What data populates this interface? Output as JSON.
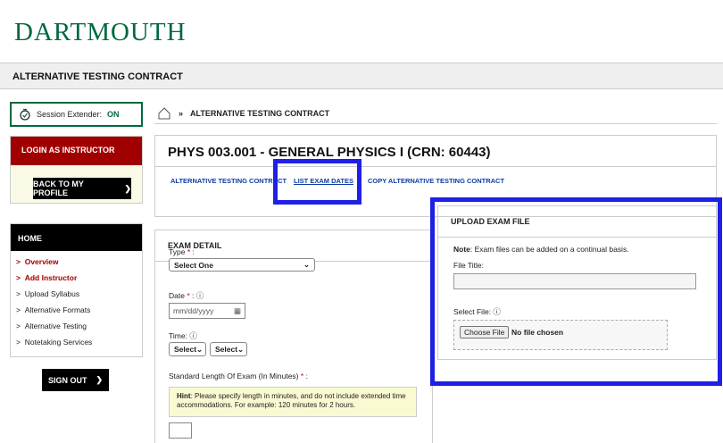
{
  "brand": {
    "logo_text": "DARTMOUTH"
  },
  "page": {
    "title": "ALTERNATIVE TESTING CONTRACT"
  },
  "session": {
    "label": "Session Extender:",
    "status": "ON"
  },
  "login": {
    "heading": "LOGIN AS INSTRUCTOR",
    "back_label": "BACK TO MY PROFILE"
  },
  "nav": {
    "heading": "HOME",
    "items": [
      {
        "label": "Overview",
        "active": true
      },
      {
        "label": "Add Instructor",
        "active": true
      },
      {
        "label": "Upload Syllabus",
        "active": false
      },
      {
        "label": "Alternative Formats",
        "active": false
      },
      {
        "label": "Alternative Testing",
        "active": false
      },
      {
        "label": "Notetaking Services",
        "active": false
      }
    ],
    "signout_label": "SIGN OUT"
  },
  "breadcrumb": {
    "separator": "»",
    "current": "ALTERNATIVE TESTING CONTRACT"
  },
  "course": {
    "title": "PHYS 003.001 - GENERAL PHYSICS I (CRN: 60443)",
    "tabs": [
      "ALTERNATIVE TESTING CONTRACT",
      "LIST EXAM DATES",
      "COPY ALTERNATIVE TESTING CONTRACT"
    ]
  },
  "exam_detail": {
    "heading": "EXAM DETAIL",
    "type_label": "Type",
    "type_value": "Select One",
    "date_label": "Date",
    "date_placeholder": "mm/dd/yyyy",
    "time_label": "Time:",
    "hour_value": "Select",
    "minute_value": "Select",
    "length_label": "Standard Length Of Exam (In Minutes)",
    "required_mark": "*",
    "hint_bold": "Hint",
    "hint_text": ": Please specify length in minutes, and do not include extended time accommodations. For example: 120 minutes for 2 hours."
  },
  "upload": {
    "heading": "UPLOAD EXAM FILE",
    "note_bold": "Note",
    "note_text": ": Exam files can be added on a continual basis.",
    "file_title_label": "File Title:",
    "select_file_label": "Select File:",
    "choose_label": "Choose File",
    "no_file_text": "No file chosen"
  },
  "colors": {
    "green": "#00693e",
    "red": "#a00000",
    "highlight": "#1f1fe6",
    "link": "#0d3da3"
  }
}
